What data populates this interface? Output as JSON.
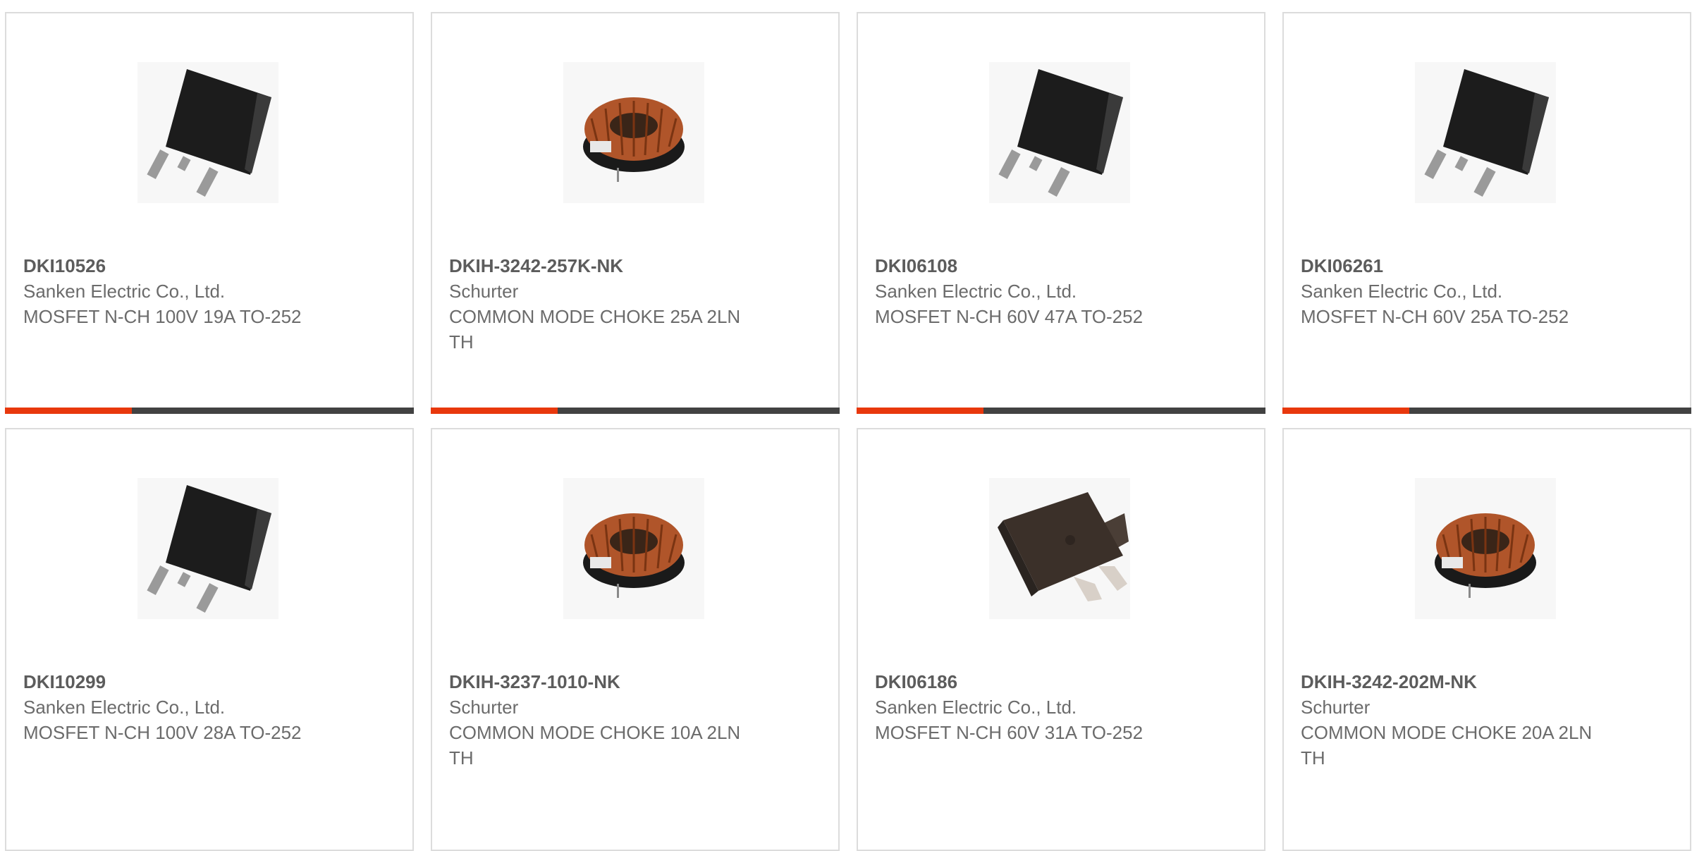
{
  "colors": {
    "accent": "#e8380d",
    "progress_track": "#424242",
    "card_border": "#dcdcdc",
    "text": "#6b6b6b"
  },
  "products": [
    {
      "part_number": "DKI10526",
      "manufacturer": "Sanken Electric Co., Ltd.",
      "description": "MOSFET N-CH 100V 19A TO-252",
      "image": "to252-mosfet-image",
      "progress": 0.31
    },
    {
      "part_number": "DKIH-3242-257K-NK",
      "manufacturer": "Schurter",
      "description": "COMMON MODE CHOKE 25A 2LN TH",
      "image": "toroid-choke-image",
      "progress": 0.31
    },
    {
      "part_number": "DKI06108",
      "manufacturer": "Sanken Electric Co., Ltd.",
      "description": "MOSFET N-CH 60V 47A TO-252",
      "image": "to252-mosfet-image",
      "progress": 0.31
    },
    {
      "part_number": "DKI06261",
      "manufacturer": "Sanken Electric Co., Ltd.",
      "description": "MOSFET N-CH 60V 25A TO-252",
      "image": "to252-mosfet-image",
      "progress": 0.31
    },
    {
      "part_number": "DKI10299",
      "manufacturer": "Sanken Electric Co., Ltd.",
      "description": "MOSFET N-CH 100V 28A TO-252",
      "image": "to252-mosfet-image"
    },
    {
      "part_number": "DKIH-3237-1010-NK",
      "manufacturer": "Schurter",
      "description": "COMMON MODE CHOKE 10A 2LN TH",
      "image": "toroid-choke-image"
    },
    {
      "part_number": "DKI06186",
      "manufacturer": "Sanken Electric Co., Ltd.",
      "description": "MOSFET N-CH 60V 31A TO-252",
      "image": "dpak-mosfet-image"
    },
    {
      "part_number": "DKIH-3242-202M-NK",
      "manufacturer": "Schurter",
      "description": "COMMON MODE CHOKE 20A 2LN TH",
      "image": "toroid-choke-image"
    }
  ]
}
